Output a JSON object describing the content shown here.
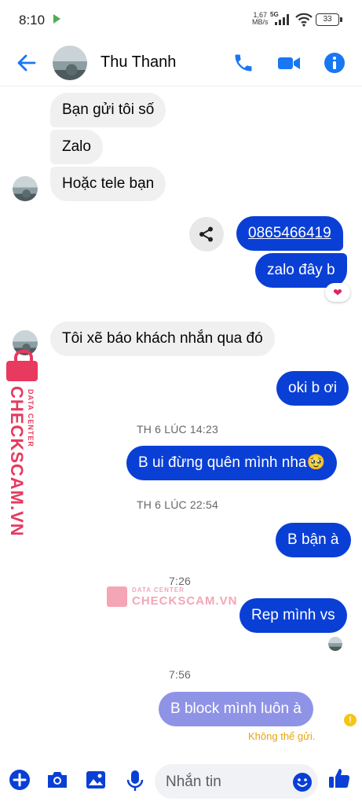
{
  "status_bar": {
    "time": "8:10",
    "speed_value": "1,67",
    "speed_unit": "MB/s",
    "network": "5G",
    "battery": "33"
  },
  "header": {
    "contact_name": "Thu Thanh",
    "icons": [
      "back-arrow-icon",
      "phone-icon",
      "video-camera-icon",
      "info-icon"
    ]
  },
  "messages": [
    {
      "side": "in",
      "text": "Bạn gửi tôi số"
    },
    {
      "side": "in",
      "text": "Zalo"
    },
    {
      "side": "in",
      "text": "Hoặc tele bạn"
    },
    {
      "side": "out",
      "text": "0865466419",
      "link": true
    },
    {
      "side": "out",
      "text": "zalo đây b",
      "reaction": "❤"
    },
    {
      "side": "in",
      "text": "Tôi xẽ báo khách nhắn qua đó"
    },
    {
      "side": "out",
      "text": "oki b ơi"
    },
    {
      "side": "timestamp",
      "text": "TH 6 LÚC 14:23"
    },
    {
      "side": "out",
      "text": "B ui đừng quên mình nha🥹"
    },
    {
      "side": "timestamp",
      "text": "TH 6 LÚC 22:54"
    },
    {
      "side": "out",
      "text": "B bận à"
    },
    {
      "side": "timestamp",
      "text": "7:26"
    },
    {
      "side": "out",
      "text": "Rep mình vs"
    },
    {
      "side": "timestamp",
      "text": "7:56"
    },
    {
      "side": "out",
      "text": "B block mình luôn à",
      "status": "Không thể gửi."
    }
  ],
  "watermark": {
    "brand": "CHECKSCAM.VN",
    "tagline": "DATA CENTER"
  },
  "composer": {
    "placeholder": "Nhắn tin",
    "icons": [
      "plus-icon",
      "camera-icon",
      "image-icon",
      "microphone-icon",
      "emoji-icon",
      "like-icon"
    ]
  },
  "colors": {
    "accent": "#0a3fd6",
    "header_icons": "#1877f2",
    "failed_bubble": "#8e93e6",
    "watermark": "#e8395f",
    "warning": "#e5a50a"
  }
}
